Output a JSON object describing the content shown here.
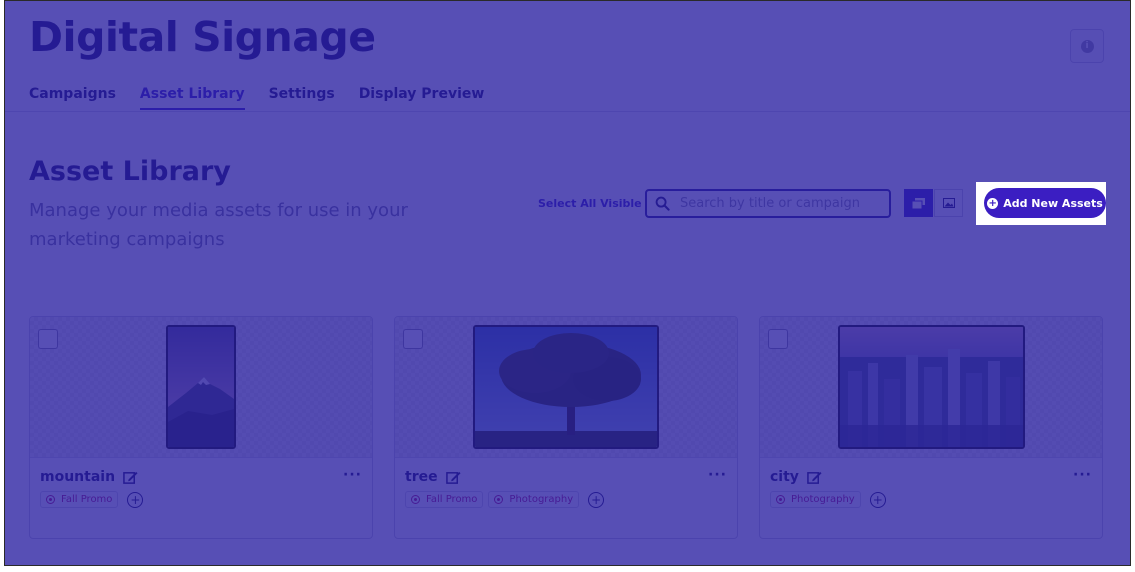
{
  "header": {
    "title": "Digital Signage"
  },
  "tabs": [
    {
      "label": "Campaigns",
      "active": false
    },
    {
      "label": "Asset Library",
      "active": true
    },
    {
      "label": "Settings",
      "active": false
    },
    {
      "label": "Display Preview",
      "active": false
    }
  ],
  "section": {
    "title": "Asset Library",
    "description": "Manage your media assets for use in your marketing campaigns"
  },
  "toolbar": {
    "select_all_label": "Select All Visible",
    "search_placeholder": "Search by title or campaign",
    "search_value": "",
    "add_button_label": "Add New Assets"
  },
  "assets": [
    {
      "name": "mountain",
      "tags": [
        "Fall Promo"
      ]
    },
    {
      "name": "tree",
      "tags": [
        "Fall Promo",
        "Photography"
      ]
    },
    {
      "name": "city",
      "tags": [
        "Photography"
      ]
    }
  ],
  "colors": {
    "brand_navy": "#1b1464",
    "accent_purple": "#3b22c6",
    "tag_magenta": "#b0166e",
    "overlay": "#281ea0"
  },
  "icons": {
    "info": "info-icon",
    "search": "search-icon",
    "grid_view": "grid-view-icon",
    "image_view": "image-view-icon",
    "add": "plus-circle-icon",
    "edit": "edit-icon",
    "more": "more-icon",
    "tag": "target-icon",
    "add_tag": "plus-icon"
  }
}
